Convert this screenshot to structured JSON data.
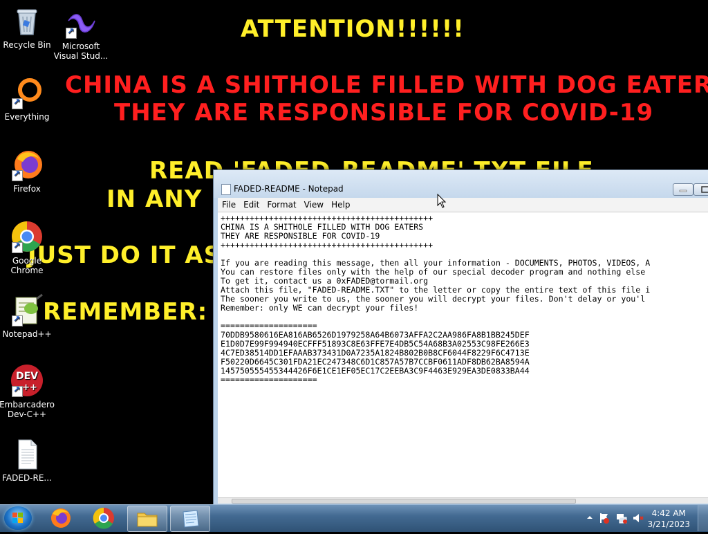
{
  "wallpaper": {
    "attention": "ATTENTION!!!!!!",
    "line1": "CHINA IS A SHITHOLE FILLED WITH DOG EATERS",
    "line2": "THEY ARE RESPONSIBLE FOR COVID-19",
    "read": "READ 'FADED-README' TXT FILE",
    "any": "IN ANY E",
    "just": "JUST DO IT AS FA",
    "remember": "REMEMBER: O"
  },
  "desktop_icons": [
    {
      "label": "Recycle Bin"
    },
    {
      "label": "Microsoft Visual Stud..."
    },
    {
      "label": "Everything"
    },
    {
      "label": "Firefox"
    },
    {
      "label": "Google Chrome"
    },
    {
      "label": "Notepad++"
    },
    {
      "label": "Embarcadero Dev-C++"
    },
    {
      "label": "FADED-RE..."
    }
  ],
  "notepad": {
    "title": "FADED-README - Notepad",
    "menu": [
      "File",
      "Edit",
      "Format",
      "View",
      "Help"
    ],
    "content": "++++++++++++++++++++++++++++++++++++++++++++\nCHINA IS A SHITHOLE FILLED WITH DOG EATERS\nTHEY ARE RESPONSIBLE FOR COVID-19\n++++++++++++++++++++++++++++++++++++++++++++\n\nIf you are reading this message, then all your information - DOCUMENTS, PHOTOS, VIDEOS, A\nYou can restore files only with the help of our special decoder program and nothing else\nTo get it, contact us a 0xFADED@tormail.org\nAttach this file, \"FADED-README.TXT\" to the letter or copy the entire text of this file i\nThe sooner you write to us, the sooner you will decrypt your files. Don't delay or you'l\nRemember: only WE can decrypt your files!\n\n====================\n70DDB9580616EA816AB6526D1979258A64B6073AFFA2C2AA986FA8B1BB245DEF\nE1D0D7E99F994940ECFFF51893C8E63FFE7E4DB5C54A68B3A02553C98FE266E3\n4C7ED38514DD1EFAAAB373431D0A7235A1824B802B0B8CF6044F8229F6C4713E\nF50220D6645C301FDA21EC247348C6D1C857A57B7CCBF0611ADF8DB62BA8594A\n145750555455344426F6E1CE1EF05EC17C2EEBA3C9F4463E929EA3DE0833BA44\n===================="
  },
  "taskbar": {
    "time": "4:42 AM",
    "date": "3/21/2023"
  },
  "colors": {
    "wallpaper_yellow": "#ffef2a",
    "wallpaper_red": "#ff1f1f"
  }
}
